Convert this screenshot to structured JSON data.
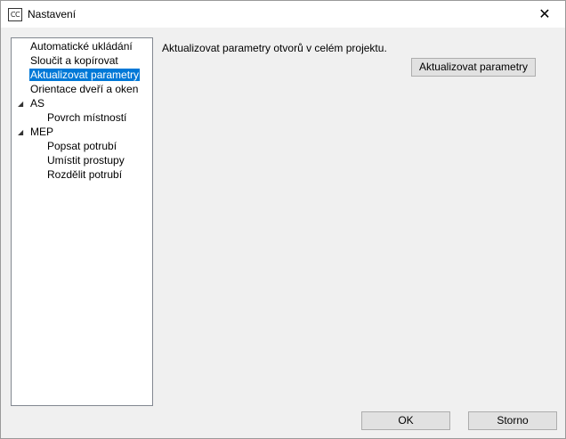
{
  "window": {
    "icon_text": "CC",
    "title": "Nastavení",
    "close_glyph": "✕"
  },
  "tree": {
    "items": [
      {
        "label": "Automatické ukládání",
        "level": 0
      },
      {
        "label": "Sloučit a kopírovat",
        "level": 0
      },
      {
        "label": "Aktualizovat parametry",
        "level": 0,
        "selected": true
      },
      {
        "label": "Orientace dveří a oken",
        "level": 0
      },
      {
        "label": "AS",
        "level": 0,
        "expanded": true
      },
      {
        "label": "Povrch místností",
        "level": 1
      },
      {
        "label": "MEP",
        "level": 0,
        "expanded": true
      },
      {
        "label": "Popsat potrubí",
        "level": 1
      },
      {
        "label": "Umístit prostupy",
        "level": 1
      },
      {
        "label": "Rozdělit potrubí",
        "level": 1
      }
    ],
    "expand_glyph": "◢"
  },
  "panel": {
    "description": "Aktualizovat parametry otvorů v celém projektu.",
    "update_button": "Aktualizovat parametry"
  },
  "footer": {
    "ok_label": "OK",
    "cancel_label": "Storno"
  }
}
